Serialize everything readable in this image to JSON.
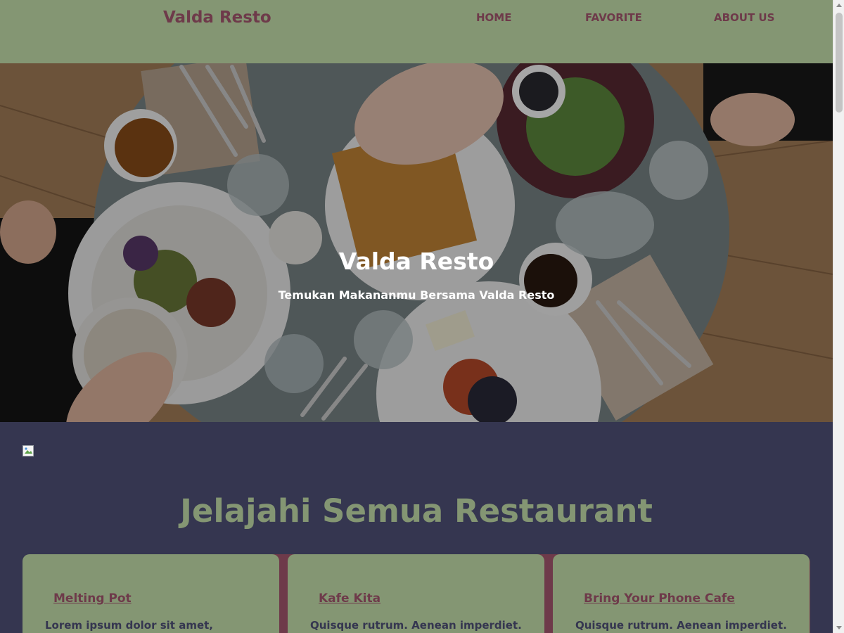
{
  "header": {
    "brand": "Valda Resto",
    "nav": [
      "HOME",
      "FAVORITE",
      "ABOUT US"
    ]
  },
  "hero": {
    "title": "Valda Resto",
    "subtitle": "Temukan Makananmu Bersama Valda Resto",
    "image_icon": "restaurant-table-photo"
  },
  "section": {
    "title": "Jelajahi Semua Restaurant"
  },
  "cards": [
    {
      "title": "Melting Pot",
      "description": "Lorem ipsum dolor sit amet,"
    },
    {
      "title": "Kafe Kita",
      "description": "Quisque rutrum. Aenean imperdiet."
    },
    {
      "title": "Bring Your Phone Cafe",
      "description": "Quisque rutrum. Aenean imperdiet."
    }
  ],
  "colors": {
    "header_bg": "#849673",
    "brand_text": "#6e3a4a",
    "body_bg": "#353650",
    "card_bg": "#849673",
    "heading_green": "#849673"
  }
}
